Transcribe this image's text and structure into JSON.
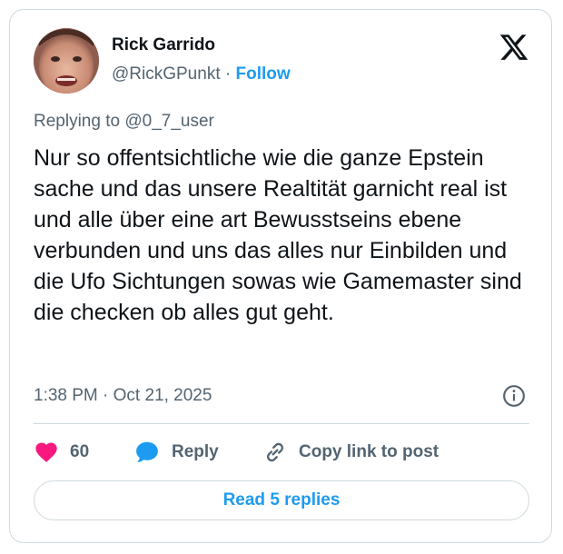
{
  "author": {
    "name": "Rick Garrido",
    "handle": "@RickGPunkt",
    "separator": "·",
    "follow_label": "Follow"
  },
  "brand_icon": "x-logo-icon",
  "replying": {
    "prefix": "Replying to",
    "mention": "@0_7_user"
  },
  "tweet": {
    "text": "Nur so offentsichtliche wie die ganze Epstein sache und das unsere Realtität garnicht real ist und alle über eine art Bewusstseins ebene verbunden und uns das alles nur Einbilden und die Ufo Sichtungen sowas wie Gamemaster sind die checken ob alles gut geht.",
    "timestamp": "1:38 PM · Oct 21, 2025"
  },
  "actions": {
    "like_count": "60",
    "reply_label": "Reply",
    "copy_label": "Copy link to post"
  },
  "read_replies_label": "Read 5 replies",
  "colors": {
    "accent": "#1d9bf0",
    "like": "#f91880",
    "text": "#0f1419",
    "muted": "#536471",
    "border": "#cfd9de"
  }
}
